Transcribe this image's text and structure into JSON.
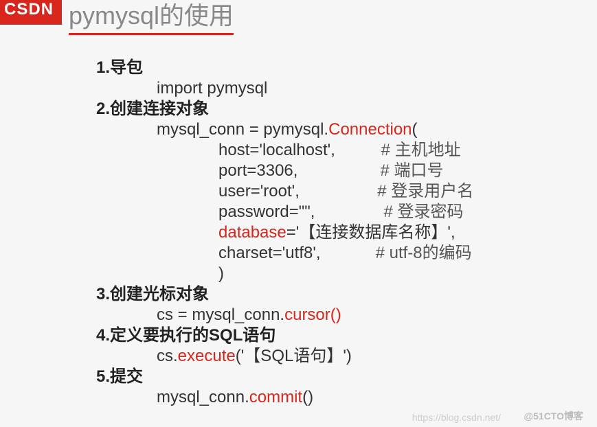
{
  "logo": "CSDN",
  "title": "pymysql的使用",
  "steps": {
    "s1": {
      "h": "1.导包",
      "line": "import pymysql"
    },
    "s2": {
      "h": "2.创建连接对象",
      "assign_pre": "mysql_conn = pymysql.",
      "assign_red": "Connection",
      "assign_post": "(",
      "params": [
        {
          "code": "host='localhost',",
          "pad": 10,
          "comment": "# 主机地址"
        },
        {
          "code": "port=3306,",
          "pad": 18,
          "comment": "# 端口号"
        },
        {
          "code": "user='root',",
          "pad": 17,
          "comment": "# 登录用户名"
        },
        {
          "code": "password=\"\",",
          "pad": 15,
          "comment": "# 登录密码"
        },
        {
          "code_red": "database",
          "code_post": "='【连接数据库名称】',",
          "pad": 0,
          "comment": ""
        },
        {
          "code": "charset='utf8',",
          "pad": 12,
          "comment": "# utf-8的编码"
        },
        {
          "code": ")",
          "pad": 0,
          "comment": ""
        }
      ]
    },
    "s3": {
      "h": "3.创建光标对象",
      "pre": "cs = mysql_conn.",
      "red": "cursor()"
    },
    "s4": {
      "h": "4.定义要执行的SQL语句",
      "pre": "cs.",
      "red": "execute",
      "post": "('【SQL语句】')"
    },
    "s5": {
      "h": "5.提交",
      "pre": "mysql_conn.",
      "red": "commit",
      "post": "()"
    }
  },
  "watermark1": "https://blog.csdn.net/",
  "watermark2": "@51CTO博客"
}
